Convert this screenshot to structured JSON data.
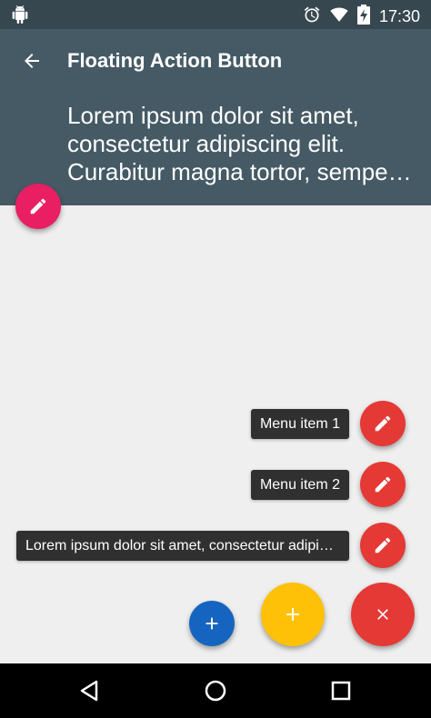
{
  "status_bar": {
    "time": "17:30",
    "icons": [
      "android-icon",
      "alarm-icon",
      "wifi-icon",
      "battery-charging-icon"
    ]
  },
  "app_bar": {
    "title": "Floating Action Button",
    "subtitle_lines": [
      "Lorem ipsum dolor sit amet,",
      "consectetur adipiscing elit.",
      "Curabitur magna tortor, semper ut"
    ],
    "color": "#455a64"
  },
  "menu": {
    "items": [
      {
        "label": "Menu item 1"
      },
      {
        "label": "Menu item 2"
      },
      {
        "label": "Lorem ipsum dolor sit amet, consectetur adipiscing elit"
      }
    ],
    "item_fab_color": "#e53935"
  },
  "fabs": {
    "header_color": "#e91e63",
    "blue_color": "#1565c0",
    "yellow_color": "#ffc107",
    "close_color": "#e53935"
  },
  "nav_bar": {
    "icons": [
      "back-triangle-icon",
      "home-circle-icon",
      "recents-square-icon"
    ]
  }
}
